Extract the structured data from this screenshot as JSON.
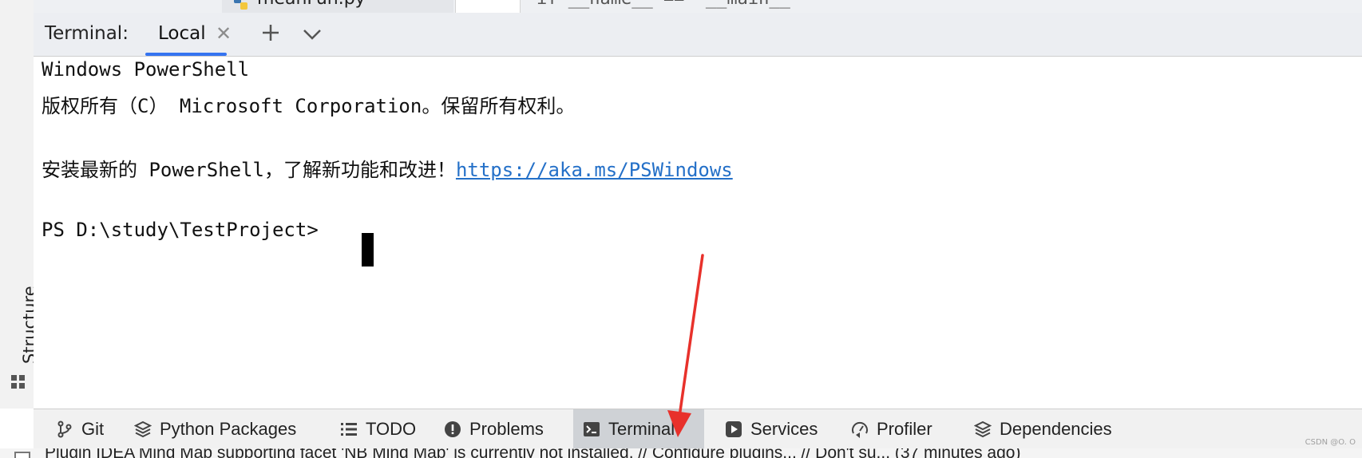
{
  "editor": {
    "file_tab_name": "meanFun.py",
    "code_fragment": "if __name__ == '__main__'"
  },
  "terminal": {
    "label": "Terminal:",
    "tab_label": "Local",
    "lines": {
      "l1": "Windows PowerShell",
      "l2": "版权所有（C） Microsoft Corporation。保留所有权利。",
      "l3_prefix": "安装最新的 PowerShell，了解新功能和改进！",
      "l3_link": "https://aka.ms/PSWindows",
      "prompt": "PS D:\\study\\TestProject> "
    }
  },
  "sidebar": {
    "structure_label": "Structure"
  },
  "toolbar": {
    "items": [
      {
        "label": "Git",
        "icon": "git-branch-icon"
      },
      {
        "label": "Python Packages",
        "icon": "layers-icon"
      },
      {
        "label": "TODO",
        "icon": "list-icon"
      },
      {
        "label": "Problems",
        "icon": "alert-circle-icon"
      },
      {
        "label": "Terminal",
        "icon": "terminal-icon",
        "active": true
      },
      {
        "label": "Services",
        "icon": "play-circle-icon"
      },
      {
        "label": "Profiler",
        "icon": "gauge-icon"
      },
      {
        "label": "Dependencies",
        "icon": "layers-icon"
      }
    ]
  },
  "status": {
    "text": "Plugin IDEA Mind Map supporting facet 'NB Mind Map' is currently not installed. // Configure plugins... // Don't su... (37 minutes ago)"
  },
  "watermark": "CSDN @O. O",
  "colors": {
    "link": "#2470c8",
    "tab_underline": "#3574f0",
    "arrow": "#e8312b",
    "active_tool_bg": "#cfd2d6"
  }
}
